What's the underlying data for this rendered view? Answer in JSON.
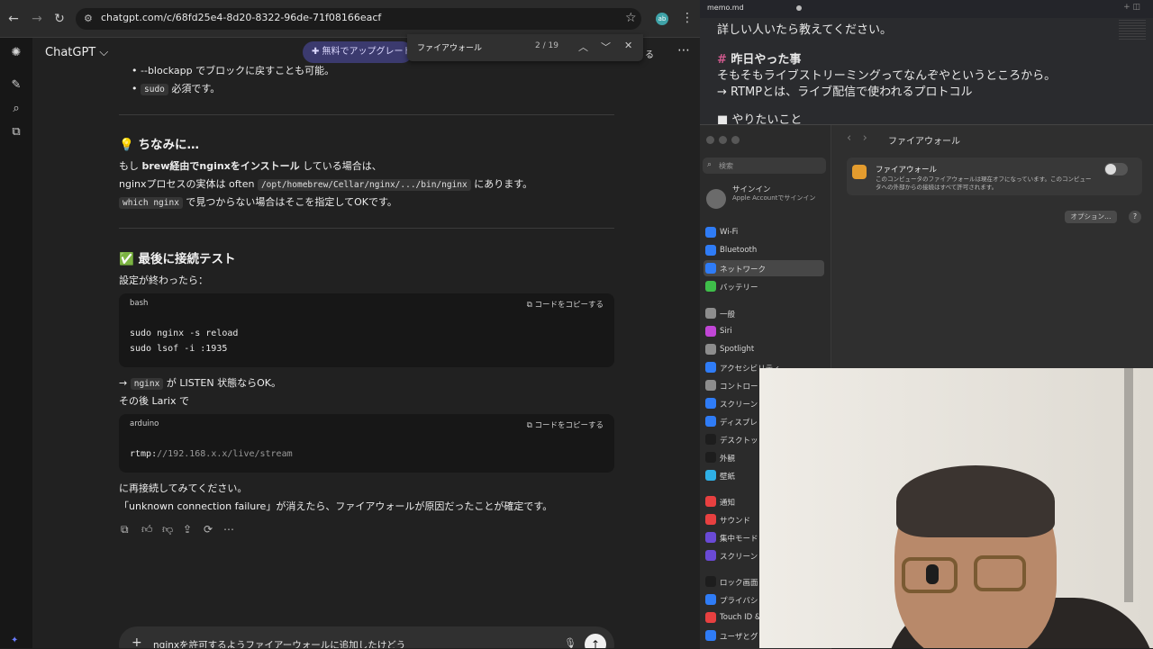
{
  "browser": {
    "url": "chatgpt.com/c/68fd25e4-8d20-8322-96de-71f08166eacf",
    "profile_initials": "ab",
    "model_name": "ChatGPT ⌵",
    "upgrade_label": "✚ 無料でアップグレード",
    "share_label": "る",
    "find": {
      "query": "ファイアウォール",
      "count": "2 / 19"
    }
  },
  "message": {
    "bullet1": "--blockapp でブロックに戻すことも可能。",
    "bullet2_code": "sudo",
    "bullet2_text": " 必須です。",
    "tip_heading": "💡 ちなみに…",
    "tip_l1_a": "もし ",
    "tip_l1_b": "brew経由でnginxをインストール",
    "tip_l1_c": " している場合は、",
    "tip_l2_a": "nginxプロセスの実体は often ",
    "tip_l2_code": "/opt/homebrew/Cellar/nginx/.../bin/nginx",
    "tip_l2_c": " にあります。",
    "tip_l3_code": "which nginx",
    "tip_l3_c": " で見つからない場合はそこを指定してOKです。",
    "test_heading": "✅ 最後に接続テスト",
    "test_intro": "設定が終わったら：",
    "code1": {
      "lang": "bash",
      "copy": "コードをコピーする",
      "lines": [
        "sudo nginx -s reload",
        "sudo lsof -i :1935"
      ]
    },
    "after1_a": "→ ",
    "after1_code": "nginx",
    "after1_c": " が LISTEN 状態ならOK。",
    "after2": "その後 Larix で",
    "code2": {
      "lang": "arduino",
      "copy": "コードをコピーする",
      "line_a": "rtmp:",
      "line_b": "//192.168.x.x/live/stream"
    },
    "outro1": "に再接続してみてください。",
    "outro2": "「unknown connection failure」が消えたら、ファイアウォールが原因だったことが確定です。"
  },
  "composer": {
    "text": "nginxを許可するようファイアーウォールに追加したけどう"
  },
  "memo": {
    "tab": "memo.md",
    "line1": "詳しい人いたら教えてください。",
    "heading_hash": "#",
    "heading": " 昨日やった事",
    "line2": "そもそもライブストリーミングってなんぞやというところから。",
    "line3": "→ RTMPとは、ライブ配信で使われるプロトコル",
    "line4": "■ やりたいこと"
  },
  "settings": {
    "search_placeholder": "検索",
    "account_name": "サインイン",
    "account_sub": "Apple Accountでサインイン",
    "title": "ファイアウォール",
    "items": [
      {
        "label": "Wi-Fi",
        "color": "#2f7cf6"
      },
      {
        "label": "Bluetooth",
        "color": "#2f7cf6"
      },
      {
        "label": "ネットワーク",
        "color": "#2f7cf6"
      },
      {
        "label": "バッテリー",
        "color": "#3fbf4a"
      },
      {
        "label": "一般",
        "color": "#8d8d8d"
      },
      {
        "label": "Siri",
        "color": "#c146d6"
      },
      {
        "label": "Spotlight",
        "color": "#8d8d8d"
      },
      {
        "label": "アクセシビリティ",
        "color": "#2f7cf6"
      },
      {
        "label": "コントロー",
        "color": "#8d8d8d"
      },
      {
        "label": "スクリーン",
        "color": "#2f7cf6"
      },
      {
        "label": "ディスプレ",
        "color": "#2f7cf6"
      },
      {
        "label": "デスクトッ",
        "color": "#1d1d1d"
      },
      {
        "label": "外観",
        "color": "#1d1d1d"
      },
      {
        "label": "壁紙",
        "color": "#2fb0e6"
      },
      {
        "label": "通知",
        "color": "#e84040"
      },
      {
        "label": "サウンド",
        "color": "#e84040"
      },
      {
        "label": "集中モード",
        "color": "#6a4ad6"
      },
      {
        "label": "スクリーン",
        "color": "#6a4ad6"
      },
      {
        "label": "ロック画面",
        "color": "#1d1d1d"
      },
      {
        "label": "プライバシ",
        "color": "#2f7cf6"
      },
      {
        "label": "Touch ID &",
        "color": "#e84040"
      },
      {
        "label": "ユーザとグ",
        "color": "#2f7cf6"
      }
    ],
    "fw_title": "ファイアウォール",
    "fw_desc": "このコンピュータのファイアウォールは現在オフになっています。このコンピュータへの外部からの接続はすべて許可されます。",
    "fw_enabled": false,
    "options_label": "オプション…",
    "help_label": "?"
  }
}
